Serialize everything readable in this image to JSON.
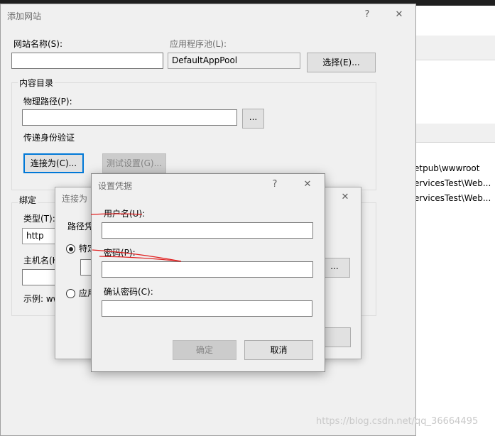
{
  "background": {
    "paths": [
      "etpub\\wwwroot",
      "ervicesTest\\Web...",
      "ervicesTest\\Web..."
    ]
  },
  "add_site": {
    "title": "添加网站",
    "help": "?",
    "close": "✕",
    "site_name_label": "网站名称(S):",
    "site_name_value": "",
    "app_pool_label": "应用程序池(L):",
    "app_pool_value": "DefaultAppPool",
    "select_button": "选择(E)...",
    "content_dir_label": "内容目录",
    "physical_path_label": "物理路径(P):",
    "physical_path_value": "",
    "browse_button": "...",
    "pass_through_label": "传递身份验证",
    "connect_as_button": "连接为(C)...",
    "test_settings_button": "测试设置(G)...",
    "binding_label": "绑定",
    "type_label": "类型(T):",
    "type_value": "http",
    "host_label": "主机名(H",
    "example_label": "示例: ww"
  },
  "connect_as": {
    "title": "连接为",
    "close": "✕",
    "path_credentials_label": "路径凭",
    "specific_user_label": "特定",
    "app_user_label": "应用",
    "specific_user_selected": true,
    "set_button": "..."
  },
  "credentials": {
    "title": "设置凭据",
    "help": "?",
    "close": "✕",
    "username_label": "用户名(U):",
    "username_value": "",
    "password_label": "密码(P):",
    "password_value": "",
    "confirm_label": "确认密码(C):",
    "confirm_value": "",
    "ok_button": "确定",
    "cancel_button": "取消"
  },
  "watermark": "https://blog.csdn.net/qq_36664495",
  "colors": {
    "accent": "#0078d7",
    "dialog_bg": "#f0f0f0",
    "annotation_red": "#e02020"
  }
}
